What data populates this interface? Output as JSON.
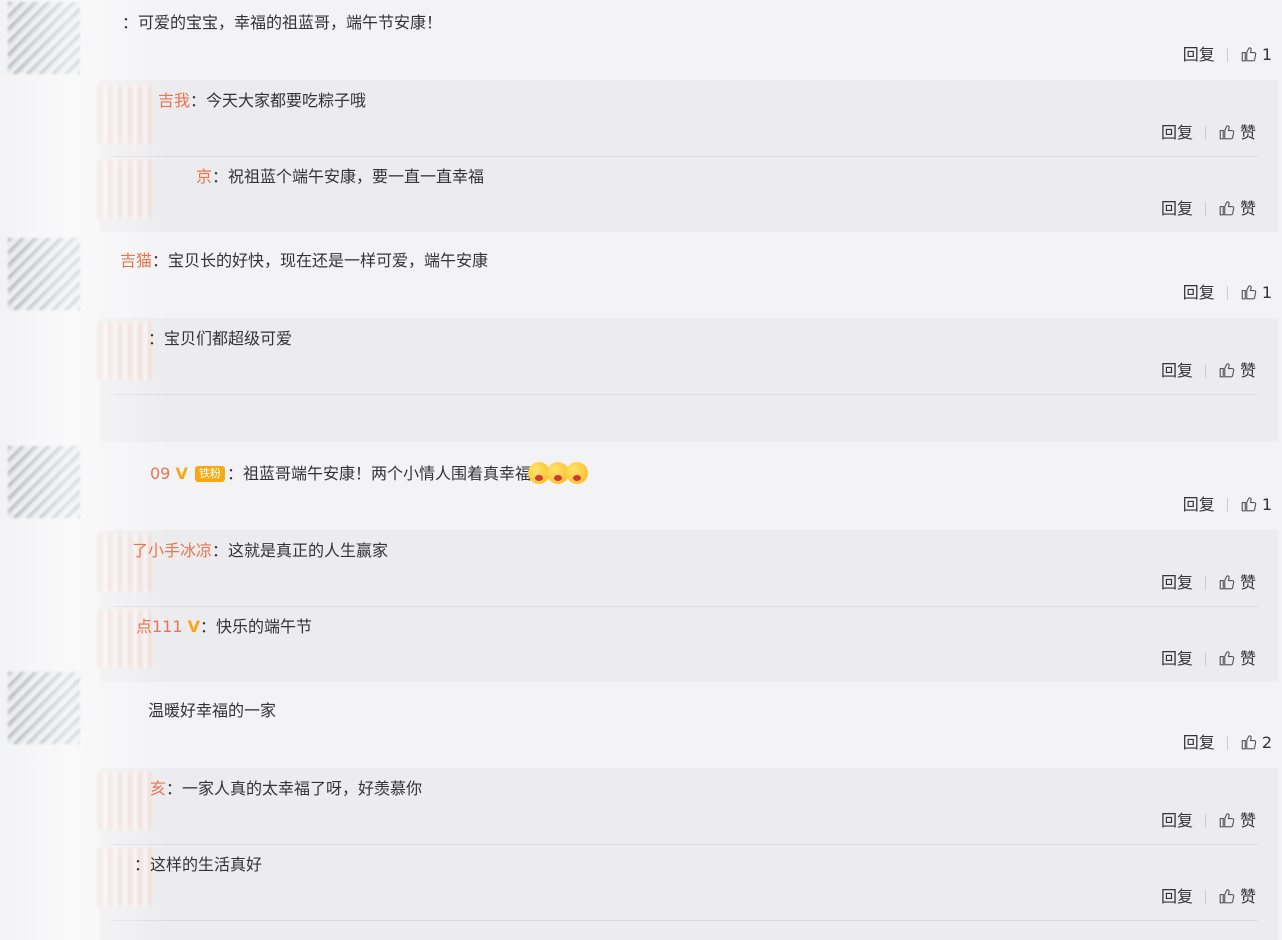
{
  "comments": [
    {
      "name": "",
      "text": "：可爱的宝宝，幸福的祖蓝哥，端午节安康！",
      "reply": "回复",
      "like": "1"
    },
    {
      "name": "吉我",
      "text": "：今天大家都要吃粽子哦",
      "reply": "回复",
      "like": "赞"
    },
    {
      "name": "京",
      "text": "：祝祖蓝个端午安康，要一直一直幸福",
      "reply": "回复",
      "like": "赞"
    },
    {
      "name": "吉猫",
      "text": "：宝贝长的好快，现在还是一样可爱，端午安康",
      "reply": "回复",
      "like": "1"
    },
    {
      "name": "",
      "text": "：宝贝们都超级可爱",
      "reply": "回复",
      "like": "赞"
    },
    {
      "name": "09",
      "vip": "V",
      "badge": "铁粉",
      "text": "：祖蓝哥端午安康！两个小情人围着真幸福",
      "reply": "回复",
      "like": "1"
    },
    {
      "name": "了小手冰凉",
      "text": "：这就是真正的人生赢家",
      "reply": "回复",
      "like": "赞"
    },
    {
      "name": "点111",
      "vip": "V",
      "text": "：快乐的端午节",
      "reply": "回复",
      "like": "赞"
    },
    {
      "name": "",
      "text": "温暖好幸福的一家",
      "reply": "回复",
      "like": "2"
    },
    {
      "name": "亥",
      "text": "：一家人真的太幸福了呀，好羡慕你",
      "reply": "回复",
      "like": "赞"
    },
    {
      "name": "",
      "text": "：这样的生活真好",
      "reply": "回复",
      "like": "赞"
    }
  ],
  "colors": {
    "name": "#eb7350",
    "vip": "#f7a914",
    "background": "#f3f3f5",
    "sub_background": "#ececee"
  },
  "icons": {
    "like": "thumbs-up-icon",
    "emoji": "heart-eyes-emoji-icon"
  }
}
